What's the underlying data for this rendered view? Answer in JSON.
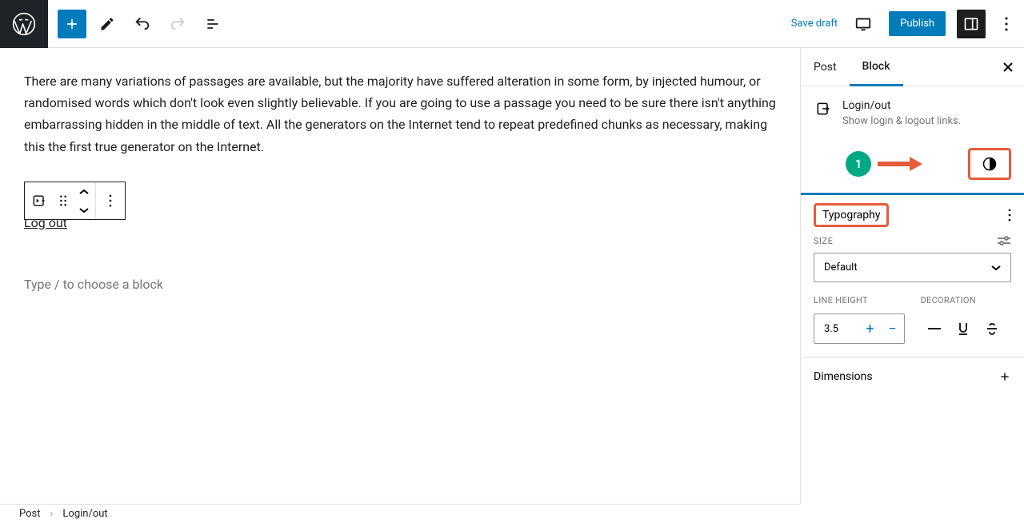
{
  "topbar": {
    "save_draft": "Save draft",
    "publish": "Publish"
  },
  "content": {
    "paragraph": "There are many variations of passages are available, but the majority have suffered alteration in some form, by injected humour, or randomised words which don't look even slightly believable. If you are going to use a passage you need to be sure there isn't anything embarrassing hidden in the middle of text. All the generators on the Internet tend to repeat predefined chunks as necessary, making this the first true generator on the Internet.",
    "login_text": "Log out",
    "placeholder": "Type / to choose a block"
  },
  "sidebar": {
    "tabs": {
      "post": "Post",
      "block": "Block"
    },
    "block": {
      "title": "Login/out",
      "desc": "Show login & logout links."
    },
    "annotation": {
      "num": "1"
    },
    "typography": {
      "title": "Typography",
      "size_label": "Size",
      "size_value": "Default",
      "line_height_label": "Line Height",
      "line_height_value": "3.5",
      "decoration_label": "Decoration"
    },
    "dimensions": {
      "title": "Dimensions"
    }
  },
  "footer": {
    "crumb1": "Post",
    "crumb2": "Login/out"
  }
}
